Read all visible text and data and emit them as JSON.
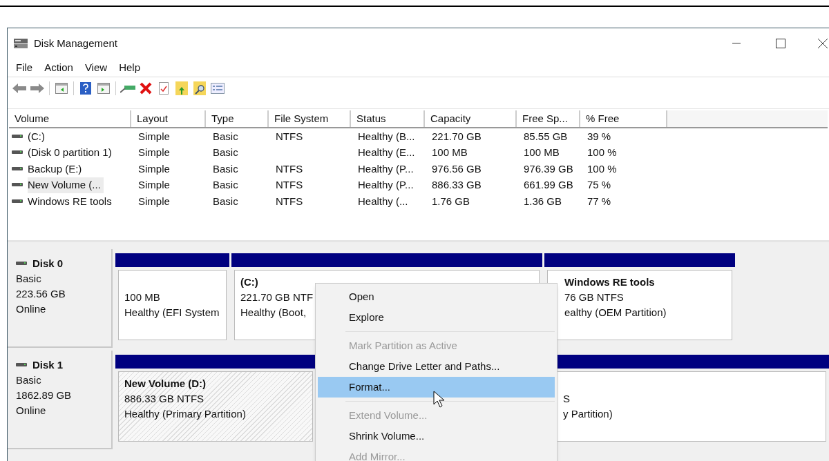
{
  "window": {
    "title": "Disk Management"
  },
  "menu_bar": [
    "File",
    "Action",
    "View",
    "Help"
  ],
  "volume_table": {
    "columns": [
      "Volume",
      "Layout",
      "Type",
      "File System",
      "Status",
      "Capacity",
      "Free Sp...",
      "% Free"
    ],
    "rows": [
      {
        "selected": false,
        "cells": [
          "(C:)",
          "Simple",
          "Basic",
          "NTFS",
          "Healthy (B...",
          "221.70 GB",
          "85.55 GB",
          "39 %"
        ]
      },
      {
        "selected": false,
        "cells": [
          "(Disk 0 partition 1)",
          "Simple",
          "Basic",
          "",
          "Healthy (E...",
          "100 MB",
          "100 MB",
          "100 %"
        ]
      },
      {
        "selected": false,
        "cells": [
          "Backup (E:)",
          "Simple",
          "Basic",
          "NTFS",
          "Healthy (P...",
          "976.56 GB",
          "976.39 GB",
          "100 %"
        ]
      },
      {
        "selected": true,
        "cells": [
          "New Volume (...",
          "Simple",
          "Basic",
          "NTFS",
          "Healthy (P...",
          "886.33 GB",
          "661.99 GB",
          "75 %"
        ]
      },
      {
        "selected": false,
        "cells": [
          "Windows RE tools",
          "Simple",
          "Basic",
          "NTFS",
          "Healthy (...",
          "1.76 GB",
          "1.36 GB",
          "77 %"
        ]
      }
    ]
  },
  "disks": [
    {
      "name": "Disk 0",
      "type": "Basic",
      "size": "223.56 GB",
      "state": "Online",
      "partitions": [
        {
          "selected": false,
          "lines": [
            "100 MB",
            "Healthy (EFI System"
          ]
        },
        {
          "selected": false,
          "title": "(C:)",
          "lines": [
            "221.70 GB NTF",
            "Healthy (Boot,"
          ]
        },
        {
          "selected": false,
          "title": "Windows RE tools",
          "lines": [
            "76 GB NTFS",
            "ealthy (OEM Partition)"
          ]
        }
      ]
    },
    {
      "name": "Disk 1",
      "type": "Basic",
      "size": "1862.89 GB",
      "state": "Online",
      "partitions": [
        {
          "selected": true,
          "title": "New Volume  (D:)",
          "lines": [
            "886.33 GB NTFS",
            "Healthy (Primary Partition)"
          ]
        },
        {
          "selected": false,
          "lines": [
            "S",
            "y Partition)"
          ]
        }
      ]
    }
  ],
  "context_menu": [
    {
      "label": "Open",
      "disabled": false,
      "selected": false
    },
    {
      "label": "Explore",
      "disabled": false,
      "selected": false
    },
    {
      "kind": "separator"
    },
    {
      "label": "Mark Partition as Active",
      "disabled": true,
      "selected": false
    },
    {
      "label": "Change Drive Letter and Paths...",
      "disabled": false,
      "selected": false
    },
    {
      "label": "Format...",
      "disabled": false,
      "selected": true
    },
    {
      "kind": "separator"
    },
    {
      "label": "Extend Volume...",
      "disabled": true,
      "selected": false
    },
    {
      "label": "Shrink Volume...",
      "disabled": false,
      "selected": false
    },
    {
      "label": "Add Mirror...",
      "disabled": true,
      "selected": false
    }
  ]
}
